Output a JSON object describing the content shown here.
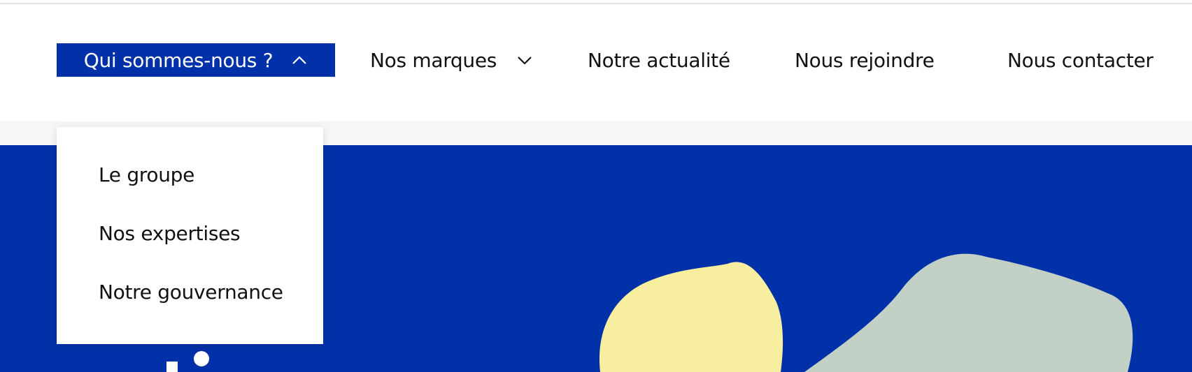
{
  "nav": {
    "items": [
      {
        "label": "Qui sommes-nous ?",
        "state": "expanded"
      },
      {
        "label": "Nos marques",
        "state": "collapsed"
      },
      {
        "label": "Notre actualité"
      },
      {
        "label": "Nous rejoindre"
      },
      {
        "label": "Nous contacter"
      }
    ]
  },
  "dropdown": {
    "items": [
      {
        "label": "Le groupe"
      },
      {
        "label": "Nos expertises"
      },
      {
        "label": "Notre gouvernance"
      }
    ]
  },
  "colors": {
    "brand_blue": "#0031a8",
    "blob_yellow": "#f8eea0",
    "blob_sage": "#c3d0c6"
  }
}
